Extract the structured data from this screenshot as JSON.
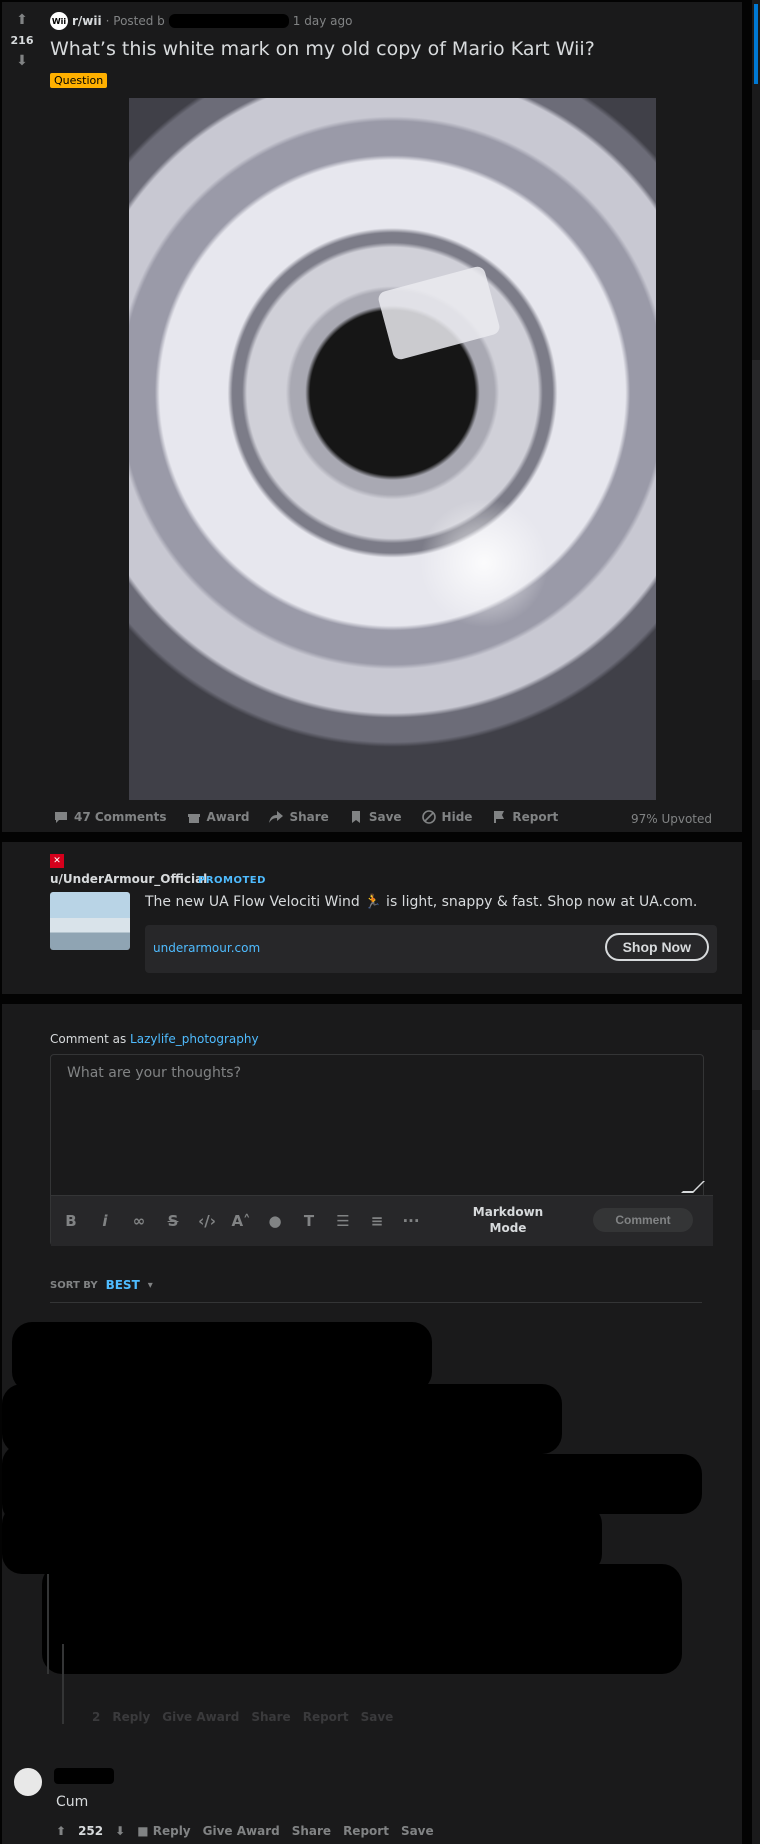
{
  "post": {
    "score": "216",
    "subreddit": "r/wii",
    "subreddit_icon": "Wii",
    "posted_by": "· Posted b",
    "time": "1 day ago",
    "title": "What’s this white mark on my old copy of Mario Kart Wii?",
    "flair": "Question",
    "actions": {
      "comments": "47 Comments",
      "award": "Award",
      "share": "Share",
      "save": "Save",
      "hide": "Hide",
      "report": "Report"
    },
    "upvoted": "97% Upvoted"
  },
  "ad": {
    "user": "u/UnderArmour_Official",
    "promoted": "PROMOTED",
    "text": "The new UA Flow Velociti Wind 🏃 is light, snappy & fast. Shop now at UA.com.",
    "domain": "underarmour.com",
    "cta": "Shop Now"
  },
  "comment_box": {
    "label": "Comment as",
    "username": "Lazylife_photography",
    "placeholder": "What are your thoughts?",
    "markdown_mode": "Markdown Mode",
    "submit": "Comment"
  },
  "sort": {
    "label": "SORT BY",
    "value": "BEST"
  },
  "faded_reply_actions": {
    "score": "2",
    "reply": "Reply",
    "give_award": "Give Award",
    "share": "Share",
    "report": "Report",
    "save": "Save"
  },
  "comment2": {
    "body": "Cum",
    "score": "252",
    "reply": "Reply",
    "give_award": "Give Award",
    "share": "Share",
    "report": "Report",
    "save": "Save"
  },
  "colors": {
    "accent": "#4fbcff",
    "flair": "#ffb000",
    "brand": "#d6001c"
  }
}
